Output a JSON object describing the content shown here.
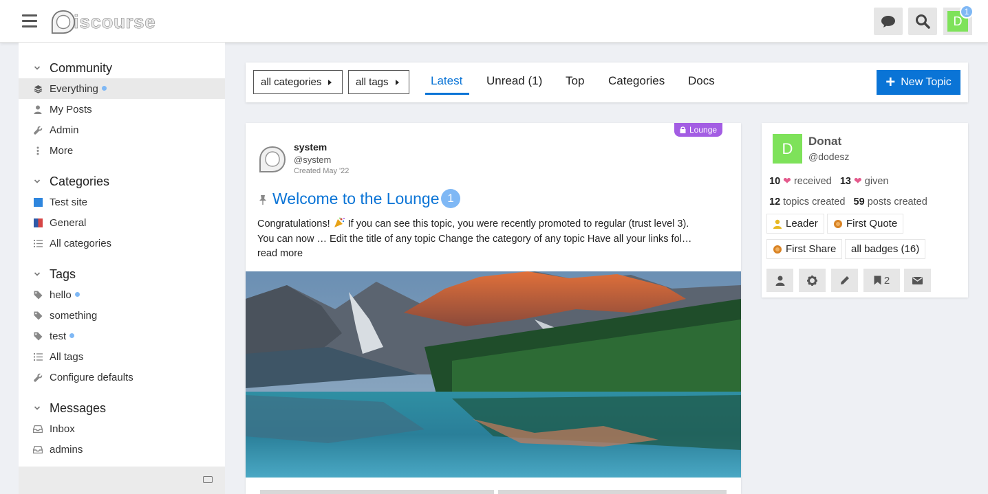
{
  "header": {
    "logo_text": "iscourse",
    "notification_count": "1",
    "avatar_letter": "D",
    "icons": [
      "hamburger-menu-icon",
      "chat-icon",
      "search-icon"
    ]
  },
  "sidebar": {
    "community": {
      "title": "Community",
      "items": [
        {
          "label": "Everything",
          "icon": "layers-icon",
          "unread": true
        },
        {
          "label": "My Posts",
          "icon": "user-icon"
        },
        {
          "label": "Admin",
          "icon": "wrench-icon"
        },
        {
          "label": "More",
          "icon": "vertical-ellipsis-icon"
        }
      ]
    },
    "categories": {
      "title": "Categories",
      "items": [
        {
          "label": "Test site",
          "color": "#2e86de"
        },
        {
          "label": "General",
          "color": "#d64545"
        },
        {
          "label": "All categories",
          "icon": "list-icon"
        }
      ]
    },
    "tags": {
      "title": "Tags",
      "items": [
        {
          "label": "hello",
          "icon": "tag-icon",
          "unread": true
        },
        {
          "label": "something",
          "icon": "tag-icon"
        },
        {
          "label": "test",
          "icon": "tag-icon",
          "unread": true
        },
        {
          "label": "All tags",
          "icon": "list-icon"
        },
        {
          "label": "Configure defaults",
          "icon": "wrench-icon"
        }
      ]
    },
    "messages": {
      "title": "Messages",
      "items": [
        {
          "label": "Inbox",
          "icon": "inbox-icon"
        },
        {
          "label": "admins",
          "icon": "inbox-icon"
        }
      ]
    }
  },
  "nav": {
    "categories_dropdown": "all categories",
    "tags_dropdown": "all tags",
    "tabs": [
      {
        "label": "Latest",
        "active": true
      },
      {
        "label": "Unread (1)"
      },
      {
        "label": "Top"
      },
      {
        "label": "Categories"
      },
      {
        "label": "Docs"
      }
    ],
    "new_topic": "New Topic"
  },
  "topic": {
    "category": "Lounge",
    "author_name": "system",
    "author_handle": "@system",
    "created": "Created May '22",
    "title": "Welcome to the Lounge",
    "reply_count": "1",
    "excerpt_before": "Congratulations! ",
    "excerpt_after": " If you can see this topic, you were recently promoted to regular (trust level 3). You can now … Edit the title of any topic Change the category of any topic Have all your links fol… ",
    "read_more": "read more",
    "image_description": "mountain-lake-landscape"
  },
  "user_card": {
    "avatar_letter": "D",
    "name": "Donat",
    "handle": "@dodesz",
    "likes_received": "10",
    "likes_received_label": "received",
    "likes_given": "13",
    "likes_given_label": "given",
    "topics_created": "12",
    "topics_created_label": "topics created",
    "posts_created": "59",
    "posts_created_label": "posts created",
    "badges": [
      {
        "label": "Leader",
        "icon": "person-badge-icon",
        "color": "#e8b923"
      },
      {
        "label": "First Quote",
        "icon": "cog-badge-icon",
        "color": "#d98324"
      },
      {
        "label": "First Share",
        "icon": "cog-badge-icon",
        "color": "#d98324"
      },
      {
        "label": "all badges (16)"
      }
    ],
    "bookmark_count": "2",
    "action_icons": [
      "user-icon",
      "gear-icon",
      "pencil-icon",
      "bookmark-icon",
      "envelope-icon"
    ]
  }
}
